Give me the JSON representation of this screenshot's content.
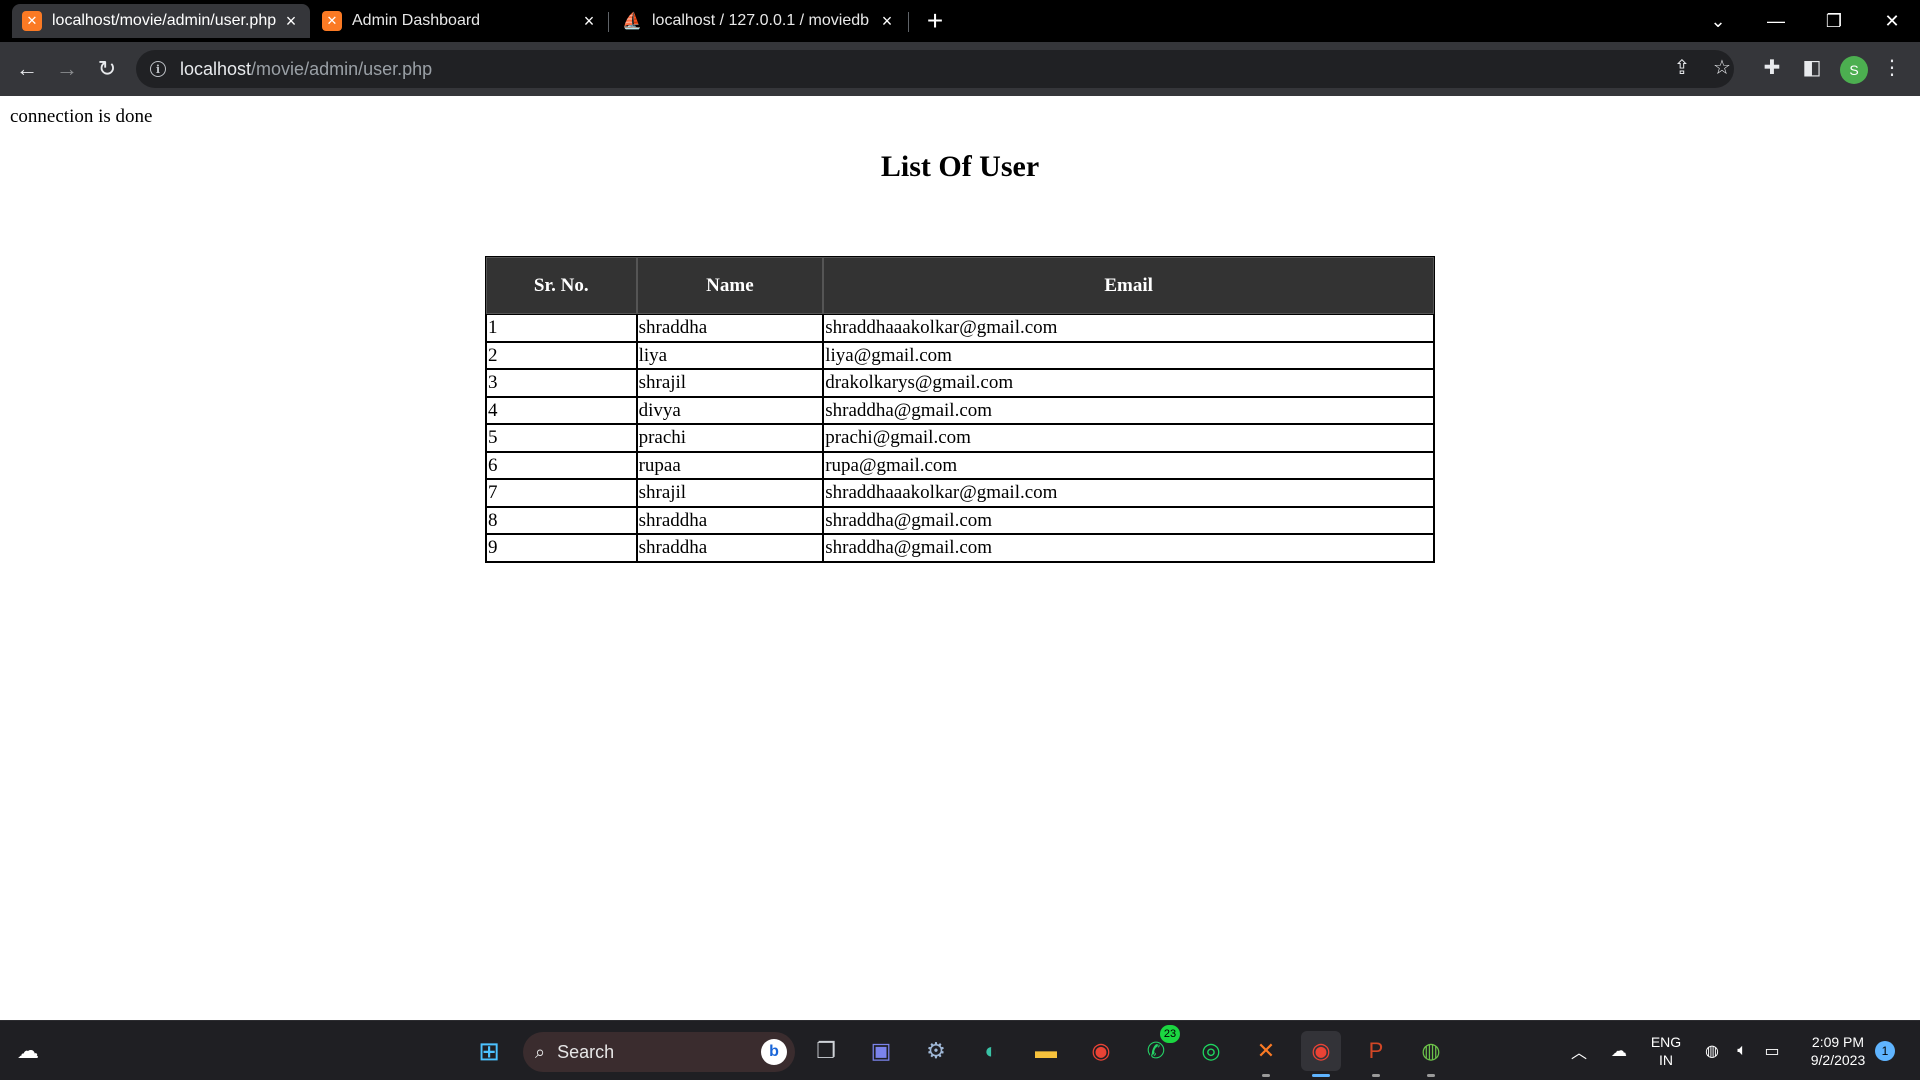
{
  "browser": {
    "tabs": [
      {
        "title": "localhost/movie/admin/user.php",
        "icon": "xampp-icon",
        "active": true
      },
      {
        "title": "Admin Dashboard",
        "icon": "xampp-icon",
        "active": false
      },
      {
        "title": "localhost / 127.0.0.1 / moviedb /",
        "icon": "phpmyadmin-icon",
        "active": false
      }
    ],
    "address": {
      "host": "localhost",
      "path": "/movie/admin/user.php"
    },
    "profile_initial": "S",
    "colors": {
      "tabbar": "#000000",
      "toolbar": "#35363a",
      "omnibox": "#202124",
      "profile": "#4caf50"
    }
  },
  "page": {
    "status_text": "connection is done",
    "title": "List Of User",
    "table": {
      "headers": [
        "Sr. No.",
        "Name",
        "Email"
      ],
      "rows": [
        [
          "1",
          "shraddha",
          "shraddhaaakolkar@gmail.com"
        ],
        [
          "2",
          "liya",
          "liya@gmail.com"
        ],
        [
          "3",
          "shrajil",
          "drakolkarys@gmail.com"
        ],
        [
          "4",
          "divya",
          "shraddha@gmail.com"
        ],
        [
          "5",
          "prachi",
          "prachi@gmail.com"
        ],
        [
          "6",
          "rupaa",
          "rupa@gmail.com"
        ],
        [
          "7",
          "shrajil",
          "shraddhaaakolkar@gmail.com"
        ],
        [
          "8",
          "shraddha",
          "shraddha@gmail.com"
        ],
        [
          "9",
          "shraddha",
          "shraddha@gmail.com"
        ]
      ],
      "header_bg": "#333333"
    }
  },
  "taskbar": {
    "search_label": "Search",
    "whatsapp_badge": "23",
    "language": {
      "line1": "ENG",
      "line2": "IN"
    },
    "clock": {
      "time": "2:09 PM",
      "date": "9/2/2023"
    },
    "notification_count": "1"
  }
}
